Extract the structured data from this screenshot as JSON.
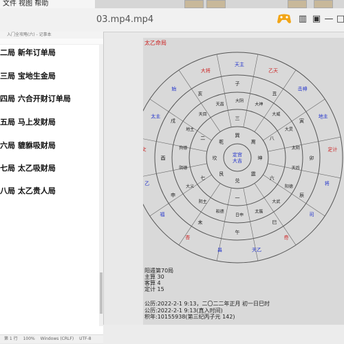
{
  "top_strip": {
    "text": "文件 视图 帮助"
  },
  "player": {
    "title": "03.mp4.mp4",
    "icons": [
      "gamepad-icon",
      "sidebar-icon",
      "window-icon",
      "minimize-icon",
      "maximize-icon"
    ]
  },
  "editor": {
    "window_title": "入门全攻略(六) - 记事本",
    "lines": [
      "二局 新年订单局",
      "三局 宝地生金局",
      "四局 六合开财订单局",
      "五局 马上发财局",
      "六局 貔貅吸财局",
      "七局 太乙吸财局",
      "八局 太乙贵人局"
    ],
    "status": [
      "第 1 行",
      "100%",
      "Windows (CRLF)",
      "UTF-8"
    ]
  },
  "chart": {
    "title": "太乙命局",
    "center": [
      "定宫",
      "大吉"
    ],
    "outer_labels": [
      "天主",
      "乙天",
      "击神",
      "地主",
      "定计",
      "将",
      "司",
      "奇",
      "天乙",
      "昌",
      "杏",
      "福",
      "乙",
      "文",
      "太主",
      "始",
      "大将"
    ],
    "ring1": [
      "巽",
      "离",
      "坤",
      "震",
      "兑",
      "艮",
      "坎",
      "乾"
    ],
    "ring1_digits": [
      "三",
      "八",
      "六",
      "一",
      "七",
      "二"
    ],
    "ring2": [
      "大阴",
      "大神",
      "大威",
      "大炅",
      "太阴",
      "天后",
      "阳德",
      "大武",
      "太簇",
      "日申",
      "和德",
      "阴主",
      "大义",
      "阴德",
      "狗德",
      "地主",
      "天目",
      "天昌"
    ],
    "branches": [
      "子",
      "丑",
      "寅",
      "卯",
      "辰",
      "巳",
      "午",
      "未",
      "申",
      "酉",
      "戌",
      "亥"
    ],
    "info": [
      "阳遁第70局",
      "主算 30",
      "客算 4",
      "定计 15",
      "",
      "公历:2022-2-1 9:13，二〇二二年正月 初一日巳时",
      "公历:2022-2-1 9:13(真入时间)",
      "积年:10155938(第三纪丙子元 142)"
    ]
  },
  "colors": {
    "accent_red": "#cc2222",
    "accent_blue": "#2233cc",
    "ring_gray": "#555555",
    "panel_bg": "#d9d9d9"
  }
}
